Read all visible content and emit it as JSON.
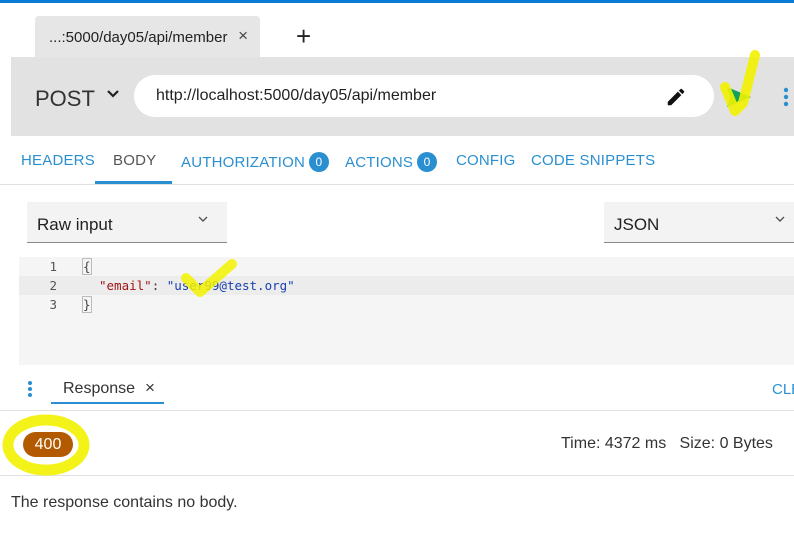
{
  "tabstrip": {
    "tab_title": "...:5000/day05/api/member",
    "close_glyph": "×",
    "new_tab_glyph": "+"
  },
  "request": {
    "method": "POST",
    "url": "http://localhost:5000/day05/api/member"
  },
  "nav": {
    "headers": "HEADERS",
    "body": "BODY",
    "authorization": "AUTHORIZATION",
    "authorization_count": "0",
    "actions": "ACTIONS",
    "actions_count": "0",
    "config": "CONFIG",
    "code_snippets": "CODE SNIPPETS",
    "active": "BODY"
  },
  "body_editor": {
    "input_type": "Raw input",
    "content_type": "JSON",
    "lines": [
      {
        "num": "1",
        "open": "{"
      },
      {
        "num": "2",
        "key": "\"email\"",
        "sep": ": ",
        "value": "\"user99@test.org\""
      },
      {
        "num": "3",
        "close": "}"
      }
    ]
  },
  "response": {
    "tab_label": "Response",
    "close_glyph": "×",
    "clear_label": "CLE",
    "status_code": "400",
    "timing": "Time: 4372 ms   Size: 0 Bytes",
    "empty_message": "The response contains no body."
  },
  "colors": {
    "accent": "#2a8fd0",
    "status_error": "#b35a00",
    "highlighter": "#f5f500"
  },
  "icons": [
    "chevron-down-icon",
    "edit-icon",
    "send-icon",
    "more-vert-icon",
    "close-icon",
    "plus-icon"
  ]
}
